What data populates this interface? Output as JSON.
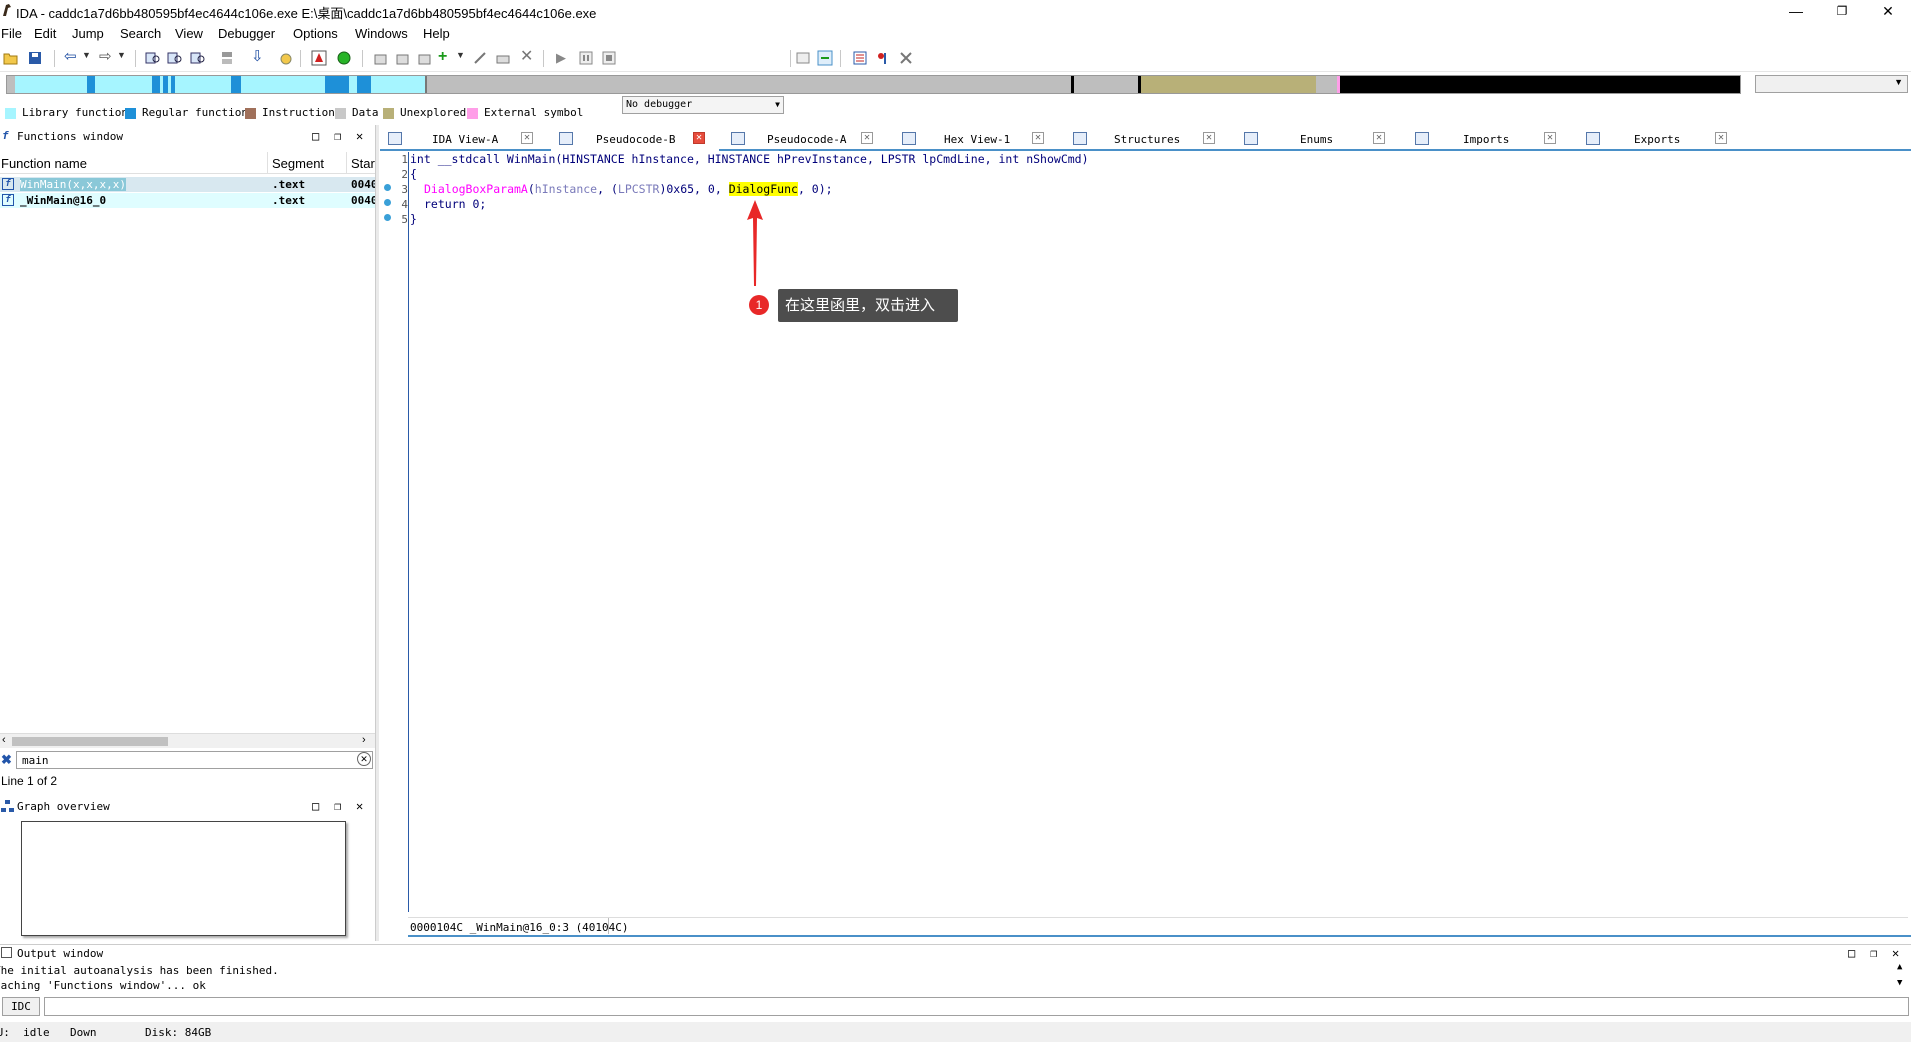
{
  "window": {
    "title": "IDA - caddc1a7d6bb480595bf4ec4644c106e.exe E:\\桌面\\caddc1a7d6bb480595bf4ec4644c106e.exe"
  },
  "menu": [
    "File",
    "Edit",
    "Jump",
    "Search",
    "View",
    "Debugger",
    "Options",
    "Windows",
    "Help"
  ],
  "toolbar": {
    "debugger": "No debugger"
  },
  "legend": [
    {
      "label": "Library function",
      "color": "#a6f5ff"
    },
    {
      "label": "Regular function",
      "color": "#1e90d8"
    },
    {
      "label": "Instruction",
      "color": "#a0705a"
    },
    {
      "label": "Data",
      "color": "#c8c8c8"
    },
    {
      "label": "Unexplored",
      "color": "#b8b078"
    },
    {
      "label": "External symbol",
      "color": "#ff9ee8"
    }
  ],
  "functions_window": {
    "title": "Functions window",
    "columns": [
      "Function name",
      "Segment",
      "Star"
    ],
    "rows": [
      {
        "name": "WinMain(x,x,x,x)",
        "segment": ".text",
        "start": "0040"
      },
      {
        "name": "_WinMain@16_0",
        "segment": ".text",
        "start": "0040"
      }
    ],
    "search": "main",
    "status": "Line 1 of 2"
  },
  "graph_overview": {
    "title": "Graph overview"
  },
  "tabs": [
    {
      "label": "IDA View-A"
    },
    {
      "label": "Pseudocode-B"
    },
    {
      "label": "Pseudocode-A"
    },
    {
      "label": "Hex View-1"
    },
    {
      "label": "Structures"
    },
    {
      "label": "Enums"
    },
    {
      "label": "Imports"
    },
    {
      "label": "Exports"
    }
  ],
  "code": {
    "line1": "int __stdcall WinMain(HINSTANCE hInstance, HINSTANCE hPrevInstance, LPSTR lpCmdLine, int nShowCmd)",
    "line2": "{",
    "line3_fn": "DialogBoxParamA",
    "line3_a": "(",
    "line3_var": "hInstance",
    "line3_b": ", (",
    "line3_cast": "LPCSTR",
    "line3_c": ")0x65, 0, ",
    "line3_hl": "DialogFunc",
    "line3_d": ", 0);",
    "line4": "return 0;",
    "line5": "}",
    "linenos": [
      "1",
      "2",
      "3",
      "4",
      "5"
    ],
    "status": "0000104C _WinMain@16_0:3 (40104C)"
  },
  "annotation": {
    "number": "1",
    "text": "在这里函里，双击进入"
  },
  "output_window": {
    "title": "Output window",
    "lines": [
      "The initial autoanalysis has been finished.",
      "Caching 'Functions window'... ok"
    ],
    "idc_label": "IDC"
  },
  "statusbar": {
    "au": "AU:  idle",
    "dir": "Down",
    "disk": "Disk: 84GB"
  }
}
